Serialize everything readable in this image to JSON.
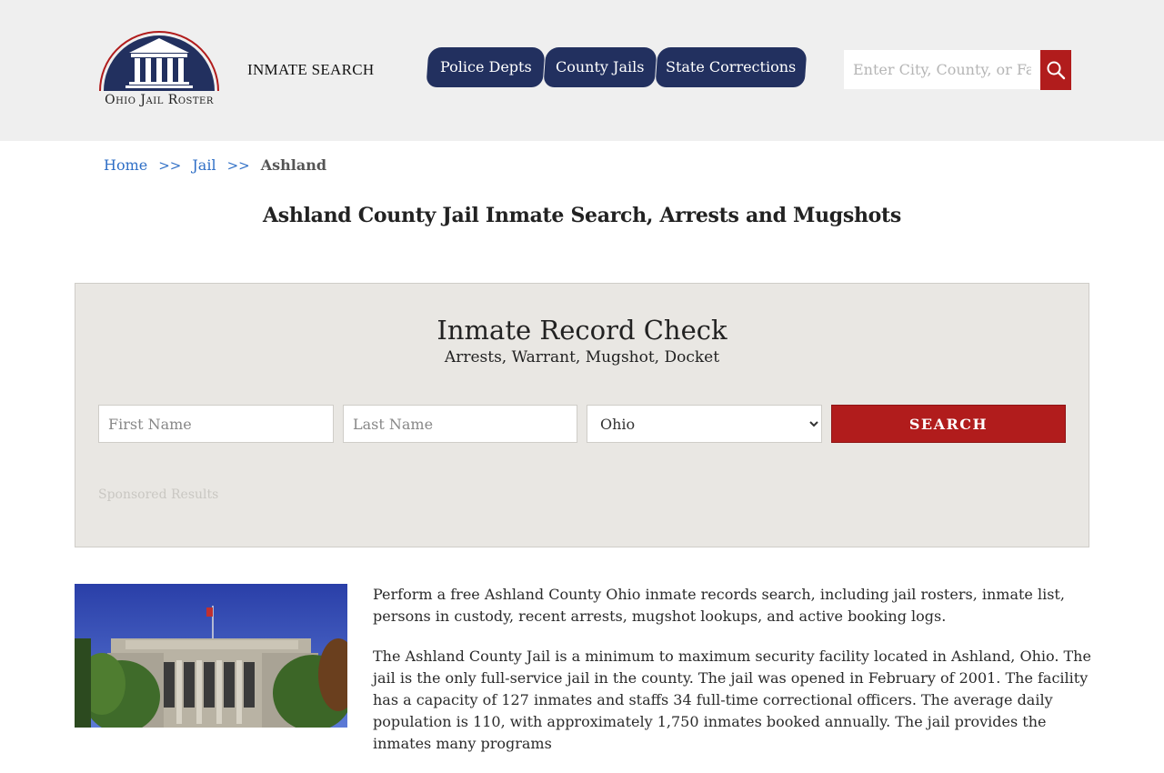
{
  "header": {
    "logo_text": "Ohio Jail Roster",
    "inmate_search_label": "INMATE SEARCH",
    "nav_tabs": [
      {
        "label": "Police Depts"
      },
      {
        "label": "County Jails"
      },
      {
        "label": "State Corrections"
      }
    ],
    "search_placeholder": "Enter City, County, or Facility",
    "search_icon": "search-icon"
  },
  "breadcrumb": {
    "home": "Home",
    "sep": ">>",
    "jail": "Jail",
    "current": "Ashland"
  },
  "page_title": "Ashland County Jail Inmate Search, Arrests and Mugshots",
  "record_check": {
    "title": "Inmate Record Check",
    "subtitle": "Arrests, Warrant, Mugshot, Docket",
    "first_name_placeholder": "First Name",
    "last_name_placeholder": "Last Name",
    "state_selected": "Ohio",
    "search_button": "SEARCH",
    "sponsored": "Sponsored Results"
  },
  "content": {
    "paragraph1": "Perform a free Ashland County Ohio inmate records search, including jail rosters, inmate list, persons in custody, recent arrests, mugshot lookups, and active booking logs.",
    "paragraph2": "The Ashland County Jail is a minimum to maximum security facility located in Ashland, Ohio. The jail is the only full-service jail in the county. The jail was opened in February of 2001. The facility has a capacity of 127 inmates and staffs 34 full-time correctional officers. The average daily population is 110, with approximately 1,750 inmates booked annually. The jail provides the inmates many programs"
  },
  "colors": {
    "nav_bg": "#22305f",
    "accent_red": "#b11c1c",
    "link_blue": "#2f6fc6",
    "header_bg": "#efefef",
    "panel_bg": "#e9e7e3"
  }
}
